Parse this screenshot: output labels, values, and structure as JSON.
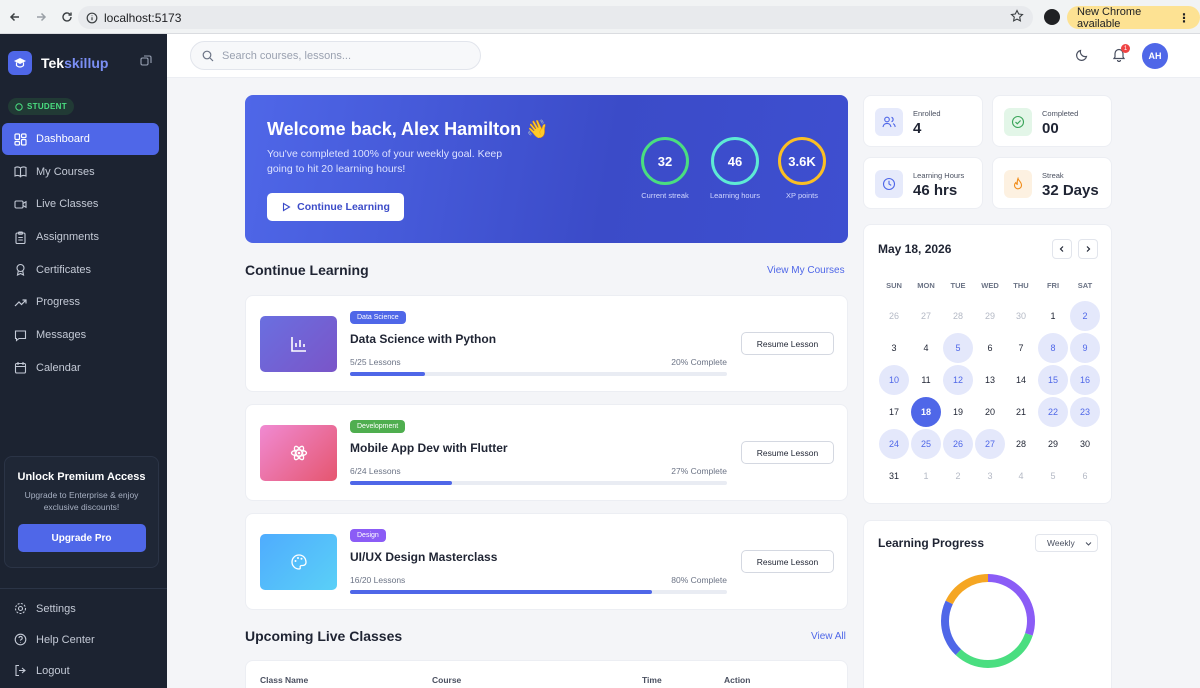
{
  "browser": {
    "url": "localhost:5173",
    "update_label": "New Chrome available"
  },
  "sidebar": {
    "brand_a": "Tek",
    "brand_b": "skillup",
    "role": "STUDENT",
    "items": [
      {
        "label": "Dashboard",
        "icon": "dashboard-icon",
        "active": true
      },
      {
        "label": "My Courses",
        "icon": "book-icon"
      },
      {
        "label": "Live Classes",
        "icon": "video-icon"
      },
      {
        "label": "Assignments",
        "icon": "clipboard-icon"
      },
      {
        "label": "Certificates",
        "icon": "award-icon"
      },
      {
        "label": "Progress",
        "icon": "trending-icon"
      },
      {
        "label": "Messages",
        "icon": "chat-icon"
      },
      {
        "label": "Calendar",
        "icon": "calendar-icon"
      }
    ],
    "promo": {
      "title": "Unlock Premium Access",
      "desc": "Upgrade to Enterprise & enjoy exclusive discounts!",
      "button": "Upgrade Pro"
    },
    "bottom": [
      {
        "label": "Settings",
        "icon": "gear-icon"
      },
      {
        "label": "Help Center",
        "icon": "help-icon"
      },
      {
        "label": "Logout",
        "icon": "logout-icon"
      }
    ]
  },
  "topbar": {
    "search_placeholder": "Search courses, lessons...",
    "notifications": "1",
    "avatar": "AH"
  },
  "hero": {
    "title": "Welcome back, Alex Hamilton 👋",
    "subtitle": "You've completed 100% of your weekly goal. Keep going to hit 20 learning hours!",
    "cta": "Continue Learning",
    "stats": [
      {
        "value": "32",
        "label": "Current streak",
        "color": "#4ade80"
      },
      {
        "value": "46",
        "label": "Learning hours",
        "color": "#5eead4"
      },
      {
        "value": "3.6K",
        "label": "XP points",
        "color": "#fbbf24"
      }
    ]
  },
  "continue": {
    "title": "Continue Learning",
    "link": "View My Courses",
    "courses": [
      {
        "tag": "Data Science",
        "title": "Data Science with Python",
        "lessons": "5/25 Lessons",
        "pct_text": "20% Complete",
        "progress": 0.2,
        "resume": "Resume Lesson",
        "tag_color": "#4f67e8",
        "thumb": [
          "#6a6fe0",
          "#7a55c8"
        ],
        "icon": "chart-icon"
      },
      {
        "tag": "Development",
        "title": "Mobile App Dev with Flutter",
        "lessons": "6/24 Lessons",
        "pct_text": "27% Complete",
        "progress": 0.27,
        "resume": "Resume Lesson",
        "tag_color": "#4fae4f",
        "thumb": [
          "#f08ad2",
          "#e5566f"
        ],
        "icon": "atom-icon"
      },
      {
        "tag": "Design",
        "title": "UI/UX Design Masterclass",
        "lessons": "16/20 Lessons",
        "pct_text": "80% Complete",
        "progress": 0.8,
        "resume": "Resume Lesson",
        "tag_color": "#8b5cf6",
        "thumb": [
          "#4facfe",
          "#5ad0f7"
        ],
        "icon": "palette-icon"
      }
    ]
  },
  "live": {
    "title": "Upcoming Live Classes",
    "link": "View All",
    "columns": [
      "Class Name",
      "Course",
      "Time",
      "Action"
    ]
  },
  "stats": [
    {
      "label": "Enrolled",
      "value": "4",
      "icon": "users-icon",
      "bg": "#e6eafb",
      "fg": "#4f67e8"
    },
    {
      "label": "Completed",
      "value": "00",
      "icon": "check-circle-icon",
      "bg": "#e3f6e8",
      "fg": "#3aa55a"
    },
    {
      "label": "Learning Hours",
      "value": "46 hrs",
      "icon": "clock-icon",
      "bg": "#e6eafb",
      "fg": "#4f67e8"
    },
    {
      "label": "Streak",
      "value": "32 Days",
      "icon": "flame-icon",
      "bg": "#fdf1e1",
      "fg": "#f08c1a"
    }
  ],
  "calendar": {
    "title": "May 18, 2026",
    "weekdays": [
      "SUN",
      "MON",
      "TUE",
      "WED",
      "THU",
      "FRI",
      "SAT"
    ],
    "weeks": [
      [
        [
          "26",
          "m"
        ],
        [
          "27",
          "m"
        ],
        [
          "28",
          "m"
        ],
        [
          "29",
          "m"
        ],
        [
          "30",
          "m"
        ],
        [
          "1",
          ""
        ],
        [
          "2",
          "h"
        ]
      ],
      [
        [
          "3",
          ""
        ],
        [
          "4",
          ""
        ],
        [
          "5",
          "h"
        ],
        [
          "6",
          ""
        ],
        [
          "7",
          ""
        ],
        [
          "8",
          "h"
        ],
        [
          "9",
          "h"
        ]
      ],
      [
        [
          "10",
          "h"
        ],
        [
          "11",
          ""
        ],
        [
          "12",
          "h"
        ],
        [
          "13",
          ""
        ],
        [
          "14",
          ""
        ],
        [
          "15",
          "h"
        ],
        [
          "16",
          "h"
        ]
      ],
      [
        [
          "17",
          ""
        ],
        [
          "18",
          "t"
        ],
        [
          "19",
          ""
        ],
        [
          "20",
          ""
        ],
        [
          "21",
          ""
        ],
        [
          "22",
          "h"
        ],
        [
          "23",
          "h"
        ]
      ],
      [
        [
          "24",
          "h"
        ],
        [
          "25",
          "h"
        ],
        [
          "26",
          "h"
        ],
        [
          "27",
          "h"
        ],
        [
          "28",
          ""
        ],
        [
          "29",
          ""
        ],
        [
          "30",
          ""
        ]
      ],
      [
        [
          "31",
          ""
        ],
        [
          "1",
          "m"
        ],
        [
          "2",
          "m"
        ],
        [
          "3",
          "m"
        ],
        [
          "4",
          "m"
        ],
        [
          "5",
          "m"
        ],
        [
          "6",
          "m"
        ]
      ]
    ]
  },
  "progress": {
    "title": "Learning Progress",
    "period": "Weekly",
    "segments": [
      {
        "color": "#8b5cf6",
        "fraction": 0.3
      },
      {
        "color": "#4ade80",
        "fraction": 0.32
      },
      {
        "color": "#4f67e8",
        "fraction": 0.2
      },
      {
        "color": "#f5a623",
        "fraction": 0.18
      }
    ]
  }
}
